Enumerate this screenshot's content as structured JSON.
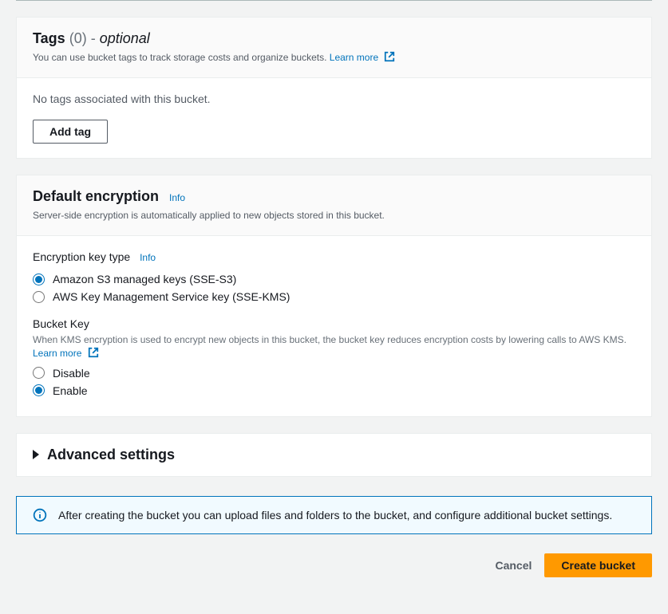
{
  "tags": {
    "title": "Tags",
    "count": "(0)",
    "optional_sep": " - ",
    "optional": "optional",
    "subtitle": "You can use bucket tags to track storage costs and organize buckets. ",
    "learn_more": "Learn more ",
    "empty": "No tags associated with this bucket.",
    "add_btn": "Add tag"
  },
  "encryption": {
    "title": "Default encryption",
    "info": "Info",
    "subtitle": "Server-side encryption is automatically applied to new objects stored in this bucket.",
    "key_type_label": "Encryption key type",
    "key_type_info": "Info",
    "option_sse_s3": "Amazon S3 managed keys (SSE-S3)",
    "option_sse_kms": "AWS Key Management Service key (SSE-KMS)",
    "bucket_key_label": "Bucket Key",
    "bucket_key_desc": "When KMS encryption is used to encrypt new objects in this bucket, the bucket key reduces encryption costs by lowering calls to AWS KMS. ",
    "bucket_key_learn": "Learn more ",
    "bk_disable": "Disable",
    "bk_enable": "Enable"
  },
  "advanced": {
    "title": "Advanced settings"
  },
  "alert": {
    "text": "After creating the bucket you can upload files and folders to the bucket, and configure additional bucket settings."
  },
  "footer": {
    "cancel": "Cancel",
    "create": "Create bucket"
  }
}
